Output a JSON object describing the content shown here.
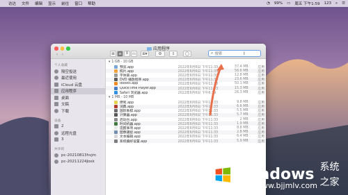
{
  "menubar": {
    "apple": "",
    "items": [
      "访达",
      "文件",
      "编辑",
      "显示",
      "前往",
      "窗口",
      "帮助"
    ],
    "battery": "99%",
    "clock": "周五 下午1:59",
    "right_extra": "123"
  },
  "window": {
    "title": "应用程序",
    "search_placeholder": "搜索",
    "toolbar": {
      "icon_view": "⊞",
      "list_view": "≡",
      "column_view": "⫴",
      "gallery_view": "▭",
      "arrange": "⚙",
      "share": "⇪",
      "tag": "◯"
    }
  },
  "sidebar": {
    "sections": [
      {
        "title": "个人收藏",
        "items": [
          {
            "label": "隔空投送",
            "icon": "airdrop-icon"
          },
          {
            "label": "最近使用",
            "icon": "clock-icon"
          },
          {
            "label": "iCloud 云盘",
            "icon": "cloud-icon"
          },
          {
            "label": "应用程序",
            "icon": "apps-icon",
            "selected": true
          },
          {
            "label": "桌面",
            "icon": "desktop-icon"
          },
          {
            "label": "文稿",
            "icon": "document-icon"
          },
          {
            "label": "下载",
            "icon": "download-icon"
          }
        ]
      },
      {
        "title": "设备",
        "items": [
          {
            "label": "2",
            "icon": "disk-icon"
          },
          {
            "label": "远程光盘",
            "icon": "disc-icon"
          },
          {
            "label": "3",
            "icon": "disk-icon"
          }
        ]
      },
      {
        "title": "共享的",
        "items": [
          {
            "label": "pc-20210813hvjm",
            "icon": "pc-icon"
          },
          {
            "label": "pc-20211224Joxk",
            "icon": "pc-icon"
          }
        ]
      }
    ]
  },
  "files": {
    "groups": [
      {
        "title": "1 GB - 10 GB",
        "rows": [
          {
            "name": "预览.app",
            "date": "2022年6月6日 下午11:33",
            "size": "37.4 MB",
            "kind": "应用",
            "color": "#7aa6d8"
          },
          {
            "name": "照片.app",
            "date": "2022年6月6日 下午11:33",
            "size": "56.6 MB",
            "kind": "应用",
            "color": "#f2a23a"
          },
          {
            "name": "字体册.app",
            "date": "2022年6月6日 下午11:33",
            "size": "12.8 MB",
            "kind": "应用",
            "color": "#9a9a9a"
          },
          {
            "name": "DVD 播放程序.app",
            "date": "2022年6月6日 下午11:33",
            "size": "23.6 MB",
            "kind": "应用",
            "color": "#5c5c5c"
          },
          {
            "name": "iBooks.app",
            "date": "2022年6月6日 下午11:33",
            "size": "50.1 MB",
            "kind": "应用",
            "color": "#f08a24"
          },
          {
            "name": "QuickTime Player.app",
            "date": "2022年6月6日 下午11:33",
            "size": "15.3 MB",
            "kind": "应用",
            "color": "#4a7fc0"
          },
          {
            "name": "Safari 浏览器.app",
            "date": "2022年6月6日 下午6:19",
            "size": "26.3 MB",
            "kind": "应用",
            "color": "#2f8fe0"
          }
        ]
      },
      {
        "title": "1 MB - 10 MB",
        "rows": [
          {
            "name": "便笺.app",
            "date": "2022年6月6日 下午11:33",
            "size": "9.8 MB",
            "kind": "应用",
            "color": "#e6d24a"
          },
          {
            "name": "词典.app",
            "date": "2022年6月6日 下午11:33",
            "size": "6.6 MB",
            "kind": "应用",
            "color": "#b03a2e"
          },
          {
            "name": "国际象棋.app",
            "date": "2022年6月6日 下午11:33",
            "size": "5.5 MB",
            "kind": "应用",
            "color": "#6b6b6b"
          },
          {
            "name": "计算器.app",
            "date": "2022年6月6日 下午11:33",
            "size": "5.7 MB",
            "kind": "应用",
            "color": "#555555"
          },
          {
            "name": "启动台.app",
            "date": "2022年6月6日 下午11:33",
            "size": "2 MB",
            "kind": "应用",
            "color": "#8a8a8a"
          },
          {
            "name": "时间机器.app",
            "date": "2022年6月6日 下午11:33",
            "size": "1.9 MB",
            "kind": "应用",
            "color": "#3e7a3e"
          },
          {
            "name": "提醒事项.app",
            "date": "2022年6月6日 下午11:33",
            "size": "8.8 MB",
            "kind": "应用",
            "color": "#e8e8e8"
          },
          {
            "name": "图像捕捉.app",
            "date": "2022年6月6日 下午11:33",
            "size": "2.8 MB",
            "kind": "应用",
            "color": "#6f8fb0"
          },
          {
            "name": "文本编辑.app",
            "date": "2022年6月6日 下午11:33",
            "size": "6.4 MB",
            "kind": "应用",
            "color": "#d8d8d8"
          },
          {
            "name": "系统偏好设置.app",
            "date": "2022年6月6日 下午11:33",
            "size": "5.9 MB",
            "kind": "应用",
            "color": "#7d7d7d"
          }
        ]
      }
    ]
  },
  "watermark": {
    "title": "Windows",
    "subtitle": "系统之家",
    "url": "www.bjjmlv.com"
  }
}
